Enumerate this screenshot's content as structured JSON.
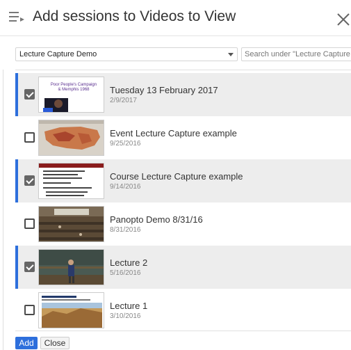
{
  "header": {
    "title": "Add sessions to Videos to View",
    "menu_icon": "list-add-icon",
    "close_icon": "close-icon"
  },
  "filters": {
    "folder": "Lecture Capture Demo",
    "search_placeholder": "Search under \"Lecture Capture Demo\""
  },
  "sessions": [
    {
      "title": "Tuesday 13 February 2017",
      "date": "2/9/2017",
      "selected": true,
      "thumb_caption": "Poor People's Campaign & Memphis 1968"
    },
    {
      "title": "Event Lecture Capture example",
      "date": "9/25/2016",
      "selected": false
    },
    {
      "title": "Course Lecture Capture example",
      "date": "9/14/2016",
      "selected": true
    },
    {
      "title": "Panopto Demo 8/31/16",
      "date": "8/31/2016",
      "selected": false
    },
    {
      "title": "Lecture 2",
      "date": "5/16/2016",
      "selected": true
    },
    {
      "title": "Lecture 1",
      "date": "3/10/2016",
      "selected": false
    }
  ],
  "footer": {
    "add_label": "Add",
    "close_label": "Close"
  },
  "colors": {
    "accent": "#2d6fdc",
    "selected_row": "#ededed"
  }
}
